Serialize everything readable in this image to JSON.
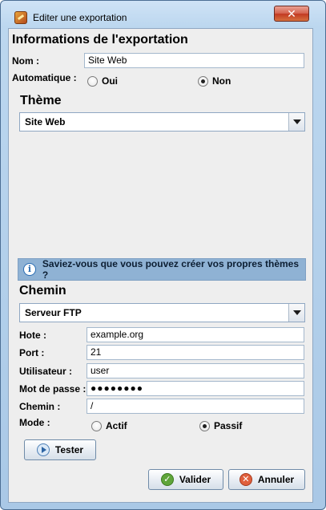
{
  "window": {
    "title": "Editer une exportation",
    "close_glyph": "✕"
  },
  "info_section": {
    "title": "Informations de l'exportation",
    "name_label": "Nom :",
    "name_value": "Site Web",
    "auto_label": "Automatique :",
    "auto_options": [
      {
        "label": "Oui",
        "checked": false
      },
      {
        "label": "Non",
        "checked": true
      }
    ]
  },
  "theme_section": {
    "title": "Thème",
    "selected": "Site Web"
  },
  "info_bar": {
    "icon_glyph": "i",
    "text": "Saviez-vous que vous pouvez créer vos propres thèmes ?"
  },
  "path_section": {
    "title": "Chemin",
    "selected": "Serveur FTP",
    "host_label": "Hote :",
    "host_value": "example.org",
    "port_label": "Port :",
    "port_value": "21",
    "user_label": "Utilisateur :",
    "user_value": "user",
    "password_label": "Mot de passe :",
    "password_value": "●●●●●●●●",
    "path_label": "Chemin :",
    "path_value": "/",
    "mode_label": "Mode :",
    "mode_options": [
      {
        "label": "Actif",
        "checked": false
      },
      {
        "label": "Passif",
        "checked": true
      }
    ]
  },
  "buttons": {
    "test": "Tester",
    "validate": "Valider",
    "validate_glyph": "✓",
    "cancel": "Annuler",
    "cancel_glyph": "✕"
  }
}
